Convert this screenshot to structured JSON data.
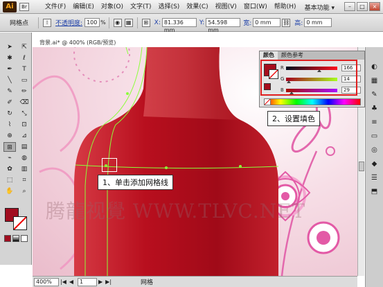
{
  "app": {
    "logo": "Ai",
    "bridge_icon": "Br",
    "workspace": "基本功能 ▾"
  },
  "menu": [
    "文件(F)",
    "编辑(E)",
    "对象(O)",
    "文字(T)",
    "选择(S)",
    "效果(C)",
    "视图(V)",
    "窗口(W)",
    "帮助(H)"
  ],
  "control_bar": {
    "selection_label": "网格点",
    "opacity_label": "不透明度:",
    "opacity_value": "100",
    "opacity_unit": "%",
    "x_label": "X:",
    "x_value": "81.336 mm",
    "y_label": "Y:",
    "y_value": "54.598 mm",
    "width_label": "宽:",
    "width_value": "0 mm",
    "height_label": "高:",
    "height_value": "0 mm"
  },
  "document": {
    "tab_title": "背景.ai* @ 400% (RGB/预览)",
    "zoom": "400%",
    "page": "1",
    "status": "网格"
  },
  "color_panel": {
    "tabs": [
      "颜色",
      "颜色参考"
    ],
    "channels": [
      {
        "label": "R",
        "value": "166",
        "fraction": 0.65
      },
      {
        "label": "G",
        "value": "14",
        "fraction": 0.05
      },
      {
        "label": "B",
        "value": "29",
        "fraction": 0.11
      }
    ],
    "fill_color": "#a60e1d"
  },
  "callouts": {
    "step1": "1、单击添加网格线",
    "step2": "2、设置填色"
  },
  "watermark": "腾龍视覺 WWW.TLVC.NET",
  "colors": {
    "bottle": "#b8101f",
    "mesh": "#8cff3a",
    "highlight_frame": "#e02020"
  }
}
